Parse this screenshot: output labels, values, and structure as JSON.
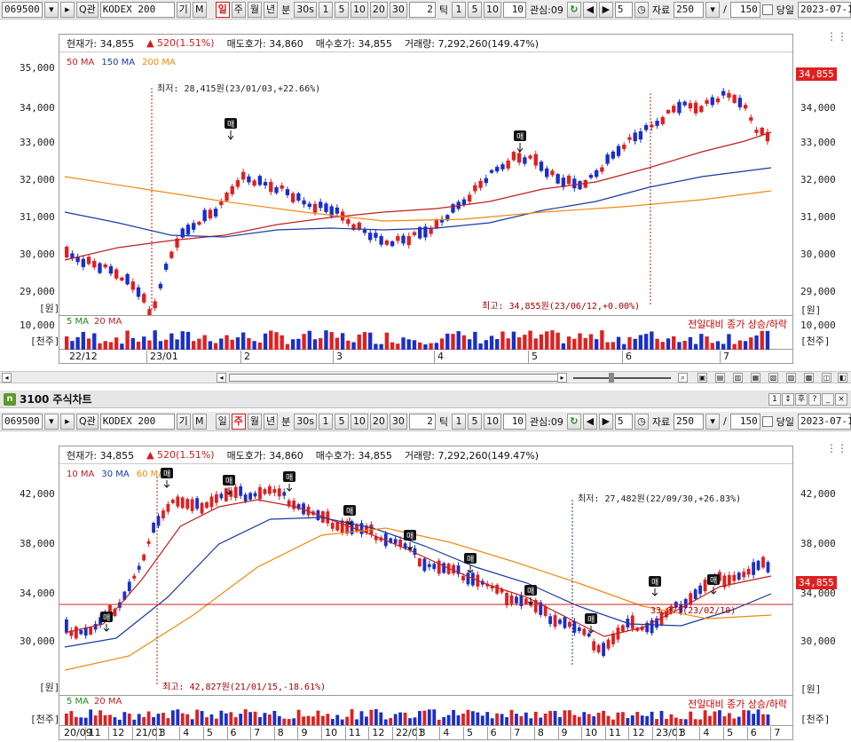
{
  "top_toolbar": {
    "code": "069500",
    "search": "Q관",
    "name": "KODEX 200",
    "btn_gi": "기",
    "btn_m": "M",
    "periods": [
      "일",
      "주",
      "월",
      "년",
      "분",
      "30s",
      "1",
      "5",
      "10",
      "20",
      "30",
      "2",
      "틱",
      "1",
      "5",
      "10",
      "10"
    ],
    "active_period": "일",
    "interest_label": "관심:09",
    "step": "5",
    "data_label": "자료",
    "data_count": "250",
    "slash": "/",
    "total": "150",
    "same_day": "당일",
    "date": "2023-07-1"
  },
  "chart1": {
    "info": {
      "current_label": "현재가:",
      "current": "34,855",
      "change": "▲ 520(1.51%)",
      "ask_label": "매도호가:",
      "ask": "34,860",
      "bid_label": "매수호가:",
      "bid": "34,855",
      "vol_label": "거래량:",
      "vol": "7,292,260(149.47%)"
    },
    "legend": [
      "50 MA",
      "150 MA",
      "200 MA"
    ],
    "y_ticks": [
      "35,000",
      "34,000",
      "33,000",
      "32,000",
      "31,000",
      "30,000",
      "29,000"
    ],
    "unit": "[원]",
    "price_tag": "34,855",
    "low_annot": "최저: 28,415원(23/01/03,+22.66%)",
    "high_annot": "최고: 34,855원(23/06/12,+0.00%)",
    "buy_label": "매",
    "vol_legend": [
      "5 MA",
      "20 MA"
    ],
    "vol_note": "전일대비 종가 상승/하락",
    "vol_tick": "10,000",
    "vol_unit": "[천주]",
    "dates": [
      "22/12",
      "23/01",
      "2",
      "3",
      "4",
      "5",
      "6",
      "7"
    ]
  },
  "panel2": {
    "number": "3100",
    "title": "주식차트",
    "win_buttons": [
      "1",
      "↕",
      "후",
      "?",
      "_",
      "×"
    ]
  },
  "bottom_toolbar": {
    "code": "069500",
    "search": "Q관",
    "name": "KODEX 200",
    "btn_gi": "기",
    "btn_m": "M",
    "periods": [
      "일",
      "주",
      "월",
      "년",
      "분",
      "30s",
      "1",
      "5",
      "10",
      "20",
      "30",
      "2",
      "틱",
      "1",
      "5",
      "10",
      "10"
    ],
    "active_period": "주",
    "interest_label": "관심:09",
    "step": "5",
    "data_label": "자료",
    "data_count": "250",
    "slash": "/",
    "total": "150",
    "same_day": "당일",
    "date": "2023-07-1"
  },
  "chart2": {
    "info": {
      "current_label": "현재가:",
      "current": "34,855",
      "change": "▲ 520(1.51%)",
      "ask_label": "매도호가:",
      "ask": "34,860",
      "bid_label": "매수호가:",
      "bid": "34,855",
      "vol_label": "거래량:",
      "vol": "7,292,260(149.47%)"
    },
    "legend": [
      "10 MA",
      "30 MA",
      "60 MA"
    ],
    "y_ticks": [
      "42,000",
      "38,000",
      "34,000",
      "30,000"
    ],
    "unit": "[원]",
    "price_tag": "34,855",
    "low_annot": "최저: 27,482원(22/09/30,+26.83%)",
    "high_annot": "최고: 42,827원(21/01/15,-18.61%)",
    "hline_annot": "33,071(23/02/10)",
    "buy_label": "매",
    "vol_legend": [
      "5 MA",
      "20 MA"
    ],
    "vol_note": "전일대비 종가 상승/하락",
    "vol_unit": "[천주]",
    "dates": [
      "20/09",
      "11",
      "12",
      "21/01",
      "3",
      "4",
      "5",
      "6",
      "7",
      "8",
      "9",
      "10",
      "11",
      "12",
      "22/01",
      "3",
      "4",
      "5",
      "6",
      "7",
      "8",
      "9",
      "10",
      "11",
      "12",
      "23/01",
      "3",
      "4",
      "5",
      "6",
      "7"
    ]
  },
  "colors": {
    "up": "#e02020",
    "down": "#1a2fc8",
    "ma_red": "#c02020",
    "ma_blue": "#1a3aa0",
    "ma_orange": "#f08a10"
  }
}
